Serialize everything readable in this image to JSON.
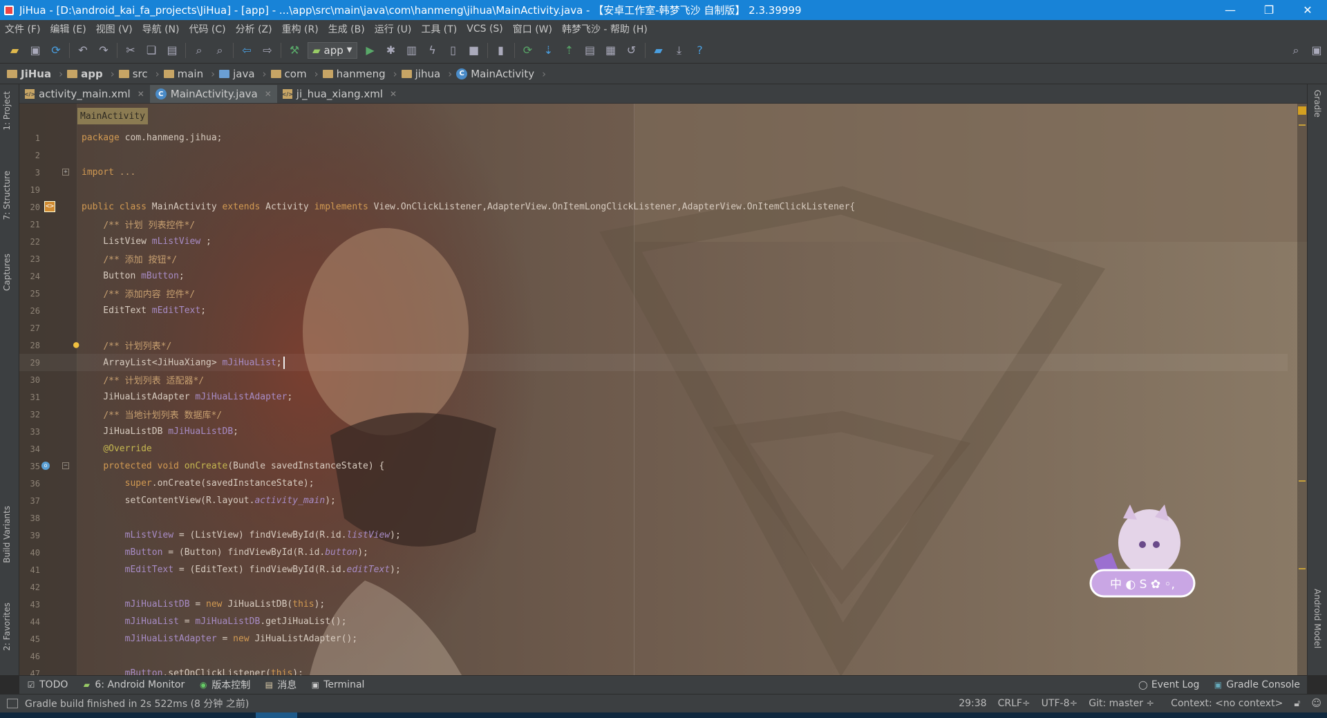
{
  "window": {
    "title": "JiHua - [D:\\android_kai_fa_projects\\JiHua] - [app] - ...\\app\\src\\main\\java\\com\\hanmeng\\jihua\\MainActivity.java - 【安卓工作室-韩梦飞沙 自制版】 2.3.39999",
    "minimize": "—",
    "restore": "❐",
    "close": "✕"
  },
  "menu": [
    "文件 (F)",
    "编辑 (E)",
    "视图 (V)",
    "导航 (N)",
    "代码 (C)",
    "分析 (Z)",
    "重构 (R)",
    "生成 (B)",
    "运行 (U)",
    "工具 (T)",
    "VCS (S)",
    "窗口 (W)",
    "韩梦飞沙 - 帮助 (H)"
  ],
  "toolbar": {
    "run_config": "app"
  },
  "breadcrumbs": [
    "JiHua",
    "app",
    "src",
    "main",
    "java",
    "com",
    "hanmeng",
    "jihua",
    "MainActivity"
  ],
  "tabs": [
    {
      "label": "activity_main.xml",
      "type": "xml",
      "active": false
    },
    {
      "label": "MainActivity.java",
      "type": "class",
      "active": true
    },
    {
      "label": "ji_hua_xiang.xml",
      "type": "xml",
      "active": false
    }
  ],
  "side_left": [
    "1: Project",
    "7: Structure",
    "Captures",
    "Build Variants",
    "2: Favorites"
  ],
  "side_right": [
    "Gradle",
    "Android Model"
  ],
  "editor": {
    "structure_hint": "MainActivity",
    "lines": [
      {
        "n": "1",
        "html": "<span class='kw'>package</span> com.hanmeng.jihua;"
      },
      {
        "n": "2",
        "html": ""
      },
      {
        "n": "3",
        "html": "<span class='kw'>import</span> <span class='cm'>...</span>",
        "fold": true
      },
      {
        "n": "19",
        "html": ""
      },
      {
        "n": "20",
        "html": "<span class='kw'>public class</span> MainActivity <span class='kw'>extends</span> Activity <span class='kw'>implements</span> View.OnClickListener,AdapterView.OnItemLongClickListener,AdapterView.OnItemClickListener{",
        "mark": "class"
      },
      {
        "n": "21",
        "html": "    <span class='cm'>/** 计划 列表控件*/</span>"
      },
      {
        "n": "22",
        "html": "    ListView <span class='fd'>mListView</span> ;"
      },
      {
        "n": "23",
        "html": "    <span class='cm'>/** 添加 按钮*/</span>"
      },
      {
        "n": "24",
        "html": "    Button <span class='fd'>mButton</span>;"
      },
      {
        "n": "25",
        "html": "    <span class='cm'>/** 添加内容 控件*/</span>"
      },
      {
        "n": "26",
        "html": "    EditText <span class='fd'>mEditText</span>;"
      },
      {
        "n": "27",
        "html": ""
      },
      {
        "n": "28",
        "html": "    <span class='cm'>/** 计划列表*/</span>",
        "mark": "bulb"
      },
      {
        "n": "29",
        "html": "    ArrayList&lt;JiHuaXiang&gt; <span class='fd'>mJiHuaList</span>;",
        "current": true
      },
      {
        "n": "30",
        "html": "    <span class='cm'>/** 计划列表 适配器*/</span>"
      },
      {
        "n": "31",
        "html": "    JiHuaListAdapter <span class='fd'>mJiHuaListAdapter</span>;"
      },
      {
        "n": "32",
        "html": "    <span class='cm'>/** 当地计划列表 数据库*/</span>"
      },
      {
        "n": "33",
        "html": "    JiHuaListDB <span class='fd'>mJiHuaListDB</span>;"
      },
      {
        "n": "34",
        "html": "    <span class='an'>@Override</span>"
      },
      {
        "n": "35",
        "html": "    <span class='kw'>protected void</span> <span class='an'>onCreate</span>(Bundle savedInstanceState) {",
        "mark": "override",
        "fold": true
      },
      {
        "n": "36",
        "html": "        <span class='kw'>super</span>.onCreate(savedInstanceState);"
      },
      {
        "n": "37",
        "html": "        setContentView(R.layout.<span class='it'>activity_main</span>);"
      },
      {
        "n": "38",
        "html": ""
      },
      {
        "n": "39",
        "html": "        <span class='fd'>mListView</span> = (ListView) findViewById(R.id.<span class='it'>listView</span>);"
      },
      {
        "n": "40",
        "html": "        <span class='fd'>mButton</span> = (Button) findViewById(R.id.<span class='it'>button</span>);"
      },
      {
        "n": "41",
        "html": "        <span class='fd'>mEditText</span> = (EditText) findViewById(R.id.<span class='it'>editText</span>);"
      },
      {
        "n": "42",
        "html": ""
      },
      {
        "n": "43",
        "html": "        <span class='fd'>mJiHuaListDB</span> = <span class='kw'>new</span> JiHuaListDB(<span class='kw'>this</span>);"
      },
      {
        "n": "44",
        "html": "        <span class='fd'>mJiHuaList</span> = <span class='fd'>mJiHuaListDB</span>.getJiHuaList();"
      },
      {
        "n": "45",
        "html": "        <span class='fd'>mJiHuaListAdapter</span> = <span class='kw'>new</span> JiHuaListAdapter();"
      },
      {
        "n": "46",
        "html": ""
      },
      {
        "n": "47",
        "html": "        <span class='fd'>mButton</span>.setOnClickListener(<span class='kw'>this</span>);"
      }
    ]
  },
  "tool_windows": {
    "left": [
      {
        "label": "TODO",
        "icon": "todo-icon"
      },
      {
        "label": "6: Android Monitor",
        "icon": "android-icon"
      },
      {
        "label": "版本控制",
        "icon": "vcs-icon"
      },
      {
        "label": "消息",
        "icon": "messages-icon"
      },
      {
        "label": "Terminal",
        "icon": "terminal-icon"
      }
    ],
    "right": [
      {
        "label": "Event Log",
        "icon": "event-log-icon"
      },
      {
        "label": "Gradle Console",
        "icon": "gradle-console-icon"
      }
    ]
  },
  "status": {
    "message": "Gradle build finished in 2s 522ms (8 分钟 之前)",
    "position": "29:38",
    "line_sep": "CRLF÷",
    "encoding": "UTF-8÷",
    "git": "Git: master ÷",
    "context": "Context: <no context>"
  },
  "mascot_text": "中 ◐ S ✿ ◦,"
}
